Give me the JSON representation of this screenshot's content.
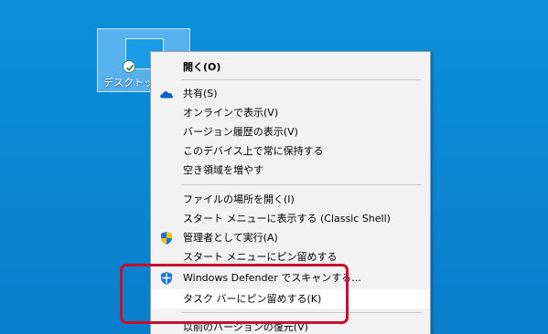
{
  "desktop": {
    "icon_label": "デスクトップ",
    "icon_name": "folder-thumbnail-icon",
    "sync_icon": "green-check-icon"
  },
  "menu": {
    "open": "開く(O)",
    "share": "共有(S)",
    "view_online": "オンラインで表示(V)",
    "version_history": "バージョン履歴の表示(V)",
    "always_keep": "このデバイス上で常に保持する",
    "free_space": "空き領域を増やす",
    "open_location": "ファイルの場所を開く(I)",
    "show_in_start": "スタート メニューに表示する (Classic Shell)",
    "run_as_admin": "管理者として実行(A)",
    "pin_to_start": "スタート メニューにピン留めする",
    "defender_scan": "Windows Defender でスキャンする...",
    "pin_to_taskbar": "タスク バーにピン留めする(K)",
    "restore_versions": "以前のバージョンの復元(V)"
  },
  "colors": {
    "desktop_bg": "#0b86d1",
    "menu_bg": "#f2f2f2",
    "highlight_border": "#c8102e",
    "onedrive_blue": "#0a64c8"
  }
}
